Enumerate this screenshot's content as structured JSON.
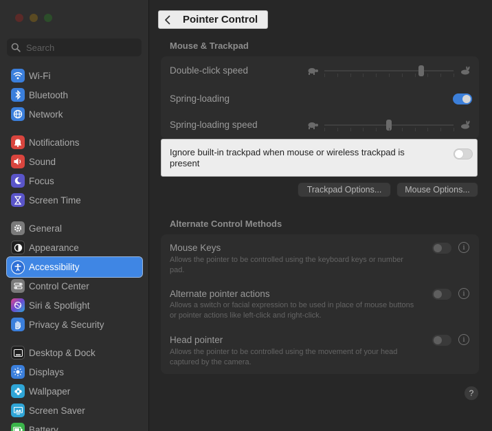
{
  "sidebar": {
    "search_placeholder": "Search",
    "items": [
      {
        "label": "Wi-Fi",
        "icon": "wifi-icon",
        "color": "#3b7fdc"
      },
      {
        "label": "Bluetooth",
        "icon": "bluetooth-icon",
        "color": "#3b7fdc"
      },
      {
        "label": "Network",
        "icon": "network-globe-icon",
        "color": "#3b7fdc"
      },
      {
        "label": "Notifications",
        "icon": "notifications-bell-icon",
        "color": "#d9453e"
      },
      {
        "label": "Sound",
        "icon": "speaker-icon",
        "color": "#d9453e"
      },
      {
        "label": "Focus",
        "icon": "moon-icon",
        "color": "#5a55c9"
      },
      {
        "label": "Screen Time",
        "icon": "hourglass-icon",
        "color": "#5a55c9"
      },
      {
        "label": "General",
        "icon": "gear-icon",
        "color": "#7a7a7a"
      },
      {
        "label": "Appearance",
        "icon": "appearance-circle-icon",
        "color": "#1e1e1e"
      },
      {
        "label": "Accessibility",
        "icon": "accessibility-person-icon",
        "color": "#2d6fd6"
      },
      {
        "label": "Control Center",
        "icon": "control-center-icon",
        "color": "#7a7a7a"
      },
      {
        "label": "Siri & Spotlight",
        "icon": "siri-icon",
        "color": "#6a4bd1"
      },
      {
        "label": "Privacy & Security",
        "icon": "hand-icon",
        "color": "#3b7fdc"
      },
      {
        "label": "Desktop & Dock",
        "icon": "dock-icon",
        "color": "#1e1e1e"
      },
      {
        "label": "Displays",
        "icon": "sun-icon",
        "color": "#3b7fdc"
      },
      {
        "label": "Wallpaper",
        "icon": "wallpaper-flower-icon",
        "color": "#2fa5d6"
      },
      {
        "label": "Screen Saver",
        "icon": "screen-saver-icon",
        "color": "#2fa5d6"
      },
      {
        "label": "Battery",
        "icon": "battery-icon",
        "color": "#3bb54a"
      }
    ],
    "selected": "Accessibility"
  },
  "header": {
    "title": "Pointer Control",
    "back_icon": "chevron-left-icon"
  },
  "mouse_trackpad": {
    "section_title": "Mouse & Trackpad",
    "double_click_label": "Double-click speed",
    "double_click_value": 0.75,
    "spring_loading_label": "Spring-loading",
    "spring_loading_on": true,
    "spring_loading_speed_label": "Spring-loading speed",
    "spring_loading_speed_value": 0.5,
    "slow_icon": "turtle-icon",
    "fast_icon": "rabbit-icon",
    "ignore_trackpad_label": "Ignore built-in trackpad when mouse or wireless trackpad is present",
    "ignore_trackpad_on": false,
    "trackpad_options_label": "Trackpad Options...",
    "mouse_options_label": "Mouse Options..."
  },
  "alternate": {
    "section_title": "Alternate Control Methods",
    "items": [
      {
        "label": "Mouse Keys",
        "desc": "Allows the pointer to be controlled using the keyboard keys or number pad.",
        "on": false
      },
      {
        "label": "Alternate pointer actions",
        "desc": "Allows a switch or facial expression to be used in place of mouse buttons or pointer actions like left-click and right-click.",
        "on": false
      },
      {
        "label": "Head pointer",
        "desc": "Allows the pointer to be controlled using the movement of your head captured by the camera.",
        "on": false
      }
    ]
  },
  "help_label": "?",
  "info_label": "i",
  "colors": {
    "accent": "#3f86e4",
    "toggle_on": "#3c7fd9",
    "highlight_bg": "#ededed"
  }
}
